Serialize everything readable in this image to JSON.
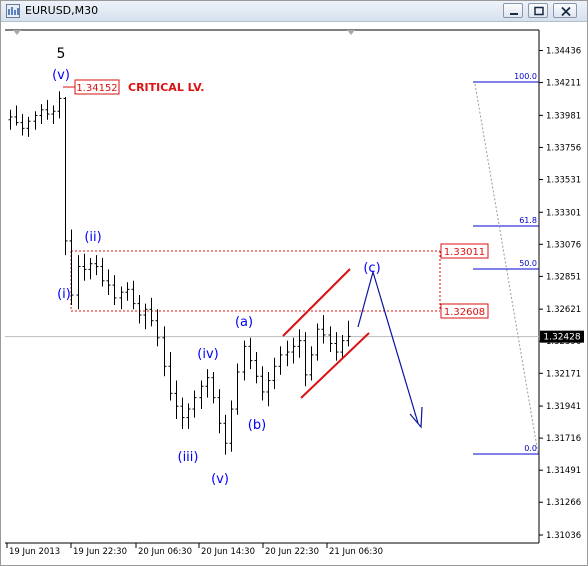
{
  "window": {
    "title": "EURUSD,M30",
    "controls": [
      "minimize",
      "restore",
      "close"
    ]
  },
  "chart_data": {
    "type": "candlestick",
    "symbol": "EURUSD",
    "timeframe": "M30",
    "ylim": [
      1.3098,
      1.3458
    ],
    "y_ticks": [
      "1.34436",
      "1.34211",
      "1.33981",
      "1.33756",
      "1.33531",
      "1.33301",
      "1.33076",
      "1.32851",
      "1.32621",
      "1.32396",
      "1.32171",
      "1.31941",
      "1.31716",
      "1.31491",
      "1.31266",
      "1.31036"
    ],
    "current_price": "1.32428",
    "x_ticks": [
      "19 Jun 2013",
      "19 Jun 22:30",
      "20 Jun 06:30",
      "20 Jun 14:30",
      "20 Jun 22:30",
      "21 Jun 06:30"
    ],
    "bars": [
      [
        1.3395,
        1.3402,
        1.3388,
        1.3397
      ],
      [
        1.3397,
        1.3405,
        1.3391,
        1.3393
      ],
      [
        1.3393,
        1.3399,
        1.3384,
        1.3389
      ],
      [
        1.3389,
        1.3397,
        1.3383,
        1.3394
      ],
      [
        1.3394,
        1.3401,
        1.3388,
        1.3398
      ],
      [
        1.3398,
        1.3406,
        1.3392,
        1.3402
      ],
      [
        1.3402,
        1.3409,
        1.3395,
        1.3399
      ],
      [
        1.3399,
        1.3405,
        1.3392,
        1.3401
      ],
      [
        1.3401,
        1.3415,
        1.3396,
        1.341
      ],
      [
        1.341,
        1.3411,
        1.33,
        1.331
      ],
      [
        1.331,
        1.3318,
        1.3265,
        1.3272
      ],
      [
        1.3272,
        1.33,
        1.3262,
        1.3292
      ],
      [
        1.3292,
        1.3301,
        1.3282,
        1.329
      ],
      [
        1.329,
        1.3298,
        1.3283,
        1.3294
      ],
      [
        1.3294,
        1.33,
        1.3286,
        1.3292
      ],
      [
        1.3292,
        1.3298,
        1.3278,
        1.3282
      ],
      [
        1.3282,
        1.329,
        1.3272,
        1.3279
      ],
      [
        1.3279,
        1.3286,
        1.3265,
        1.327
      ],
      [
        1.327,
        1.3278,
        1.3262,
        1.3274
      ],
      [
        1.3274,
        1.3281,
        1.3268,
        1.3276
      ],
      [
        1.3276,
        1.3282,
        1.3262,
        1.3266
      ],
      [
        1.3266,
        1.3272,
        1.3252,
        1.3258
      ],
      [
        1.3258,
        1.3266,
        1.3248,
        1.3262
      ],
      [
        1.3262,
        1.327,
        1.325,
        1.3254
      ],
      [
        1.3254,
        1.3262,
        1.3236,
        1.3242
      ],
      [
        1.3242,
        1.325,
        1.3215,
        1.3222
      ],
      [
        1.3222,
        1.3232,
        1.3198,
        1.3203
      ],
      [
        1.3203,
        1.3212,
        1.3185,
        1.3194
      ],
      [
        1.3194,
        1.32,
        1.3178,
        1.3186
      ],
      [
        1.3186,
        1.3196,
        1.3178,
        1.3192
      ],
      [
        1.3192,
        1.3205,
        1.3186,
        1.32
      ],
      [
        1.32,
        1.3212,
        1.3192,
        1.3208
      ],
      [
        1.3208,
        1.322,
        1.32,
        1.3214
      ],
      [
        1.3214,
        1.3218,
        1.3196,
        1.32
      ],
      [
        1.32,
        1.3206,
        1.3175,
        1.3182
      ],
      [
        1.3182,
        1.3188,
        1.316,
        1.3168
      ],
      [
        1.3168,
        1.3198,
        1.3162,
        1.3192
      ],
      [
        1.3192,
        1.3224,
        1.3188,
        1.3218
      ],
      [
        1.3218,
        1.324,
        1.3212,
        1.3236
      ],
      [
        1.3236,
        1.3242,
        1.322,
        1.3226
      ],
      [
        1.3226,
        1.3232,
        1.321,
        1.3215
      ],
      [
        1.3215,
        1.3222,
        1.3198,
        1.3204
      ],
      [
        1.3204,
        1.3218,
        1.3194,
        1.3212
      ],
      [
        1.3212,
        1.3228,
        1.3206,
        1.3222
      ],
      [
        1.3222,
        1.3236,
        1.3216,
        1.323
      ],
      [
        1.323,
        1.324,
        1.3222,
        1.3232
      ],
      [
        1.3232,
        1.3242,
        1.3224,
        1.3236
      ],
      [
        1.3236,
        1.3248,
        1.3228,
        1.324
      ],
      [
        1.324,
        1.3246,
        1.3208,
        1.3216
      ],
      [
        1.3216,
        1.3236,
        1.3212,
        1.323
      ],
      [
        1.323,
        1.3252,
        1.3226,
        1.3248
      ],
      [
        1.3248,
        1.3258,
        1.3238,
        1.3244
      ],
      [
        1.3244,
        1.325,
        1.3232,
        1.3238
      ],
      [
        1.3238,
        1.3246,
        1.3226,
        1.3232
      ],
      [
        1.3232,
        1.3244,
        1.3228,
        1.324
      ],
      [
        1.324,
        1.3254,
        1.3236,
        1.3243
      ]
    ]
  },
  "labels": {
    "wave5": "5",
    "v_top": "(v)",
    "ii": "(ii)",
    "i": "(i)",
    "iii": "(iii)",
    "iv": "(iv)",
    "v_low": "(v)",
    "a": "(a)",
    "b": "(b)",
    "c": "(c)"
  },
  "critical": {
    "price": "1.34152",
    "text": "CRITICAL LV."
  },
  "box_levels": {
    "upper": "1.33011",
    "lower": "1.32608"
  },
  "fib_levels": [
    "100.0",
    "61.8",
    "50.0",
    "0.0"
  ],
  "colors": {
    "red": "#dd1111",
    "blue": "#0000ff",
    "navy": "#0a14a0",
    "candle": "#000000",
    "fib": "#0000cc",
    "axis": "#000000",
    "current": "#000000"
  }
}
